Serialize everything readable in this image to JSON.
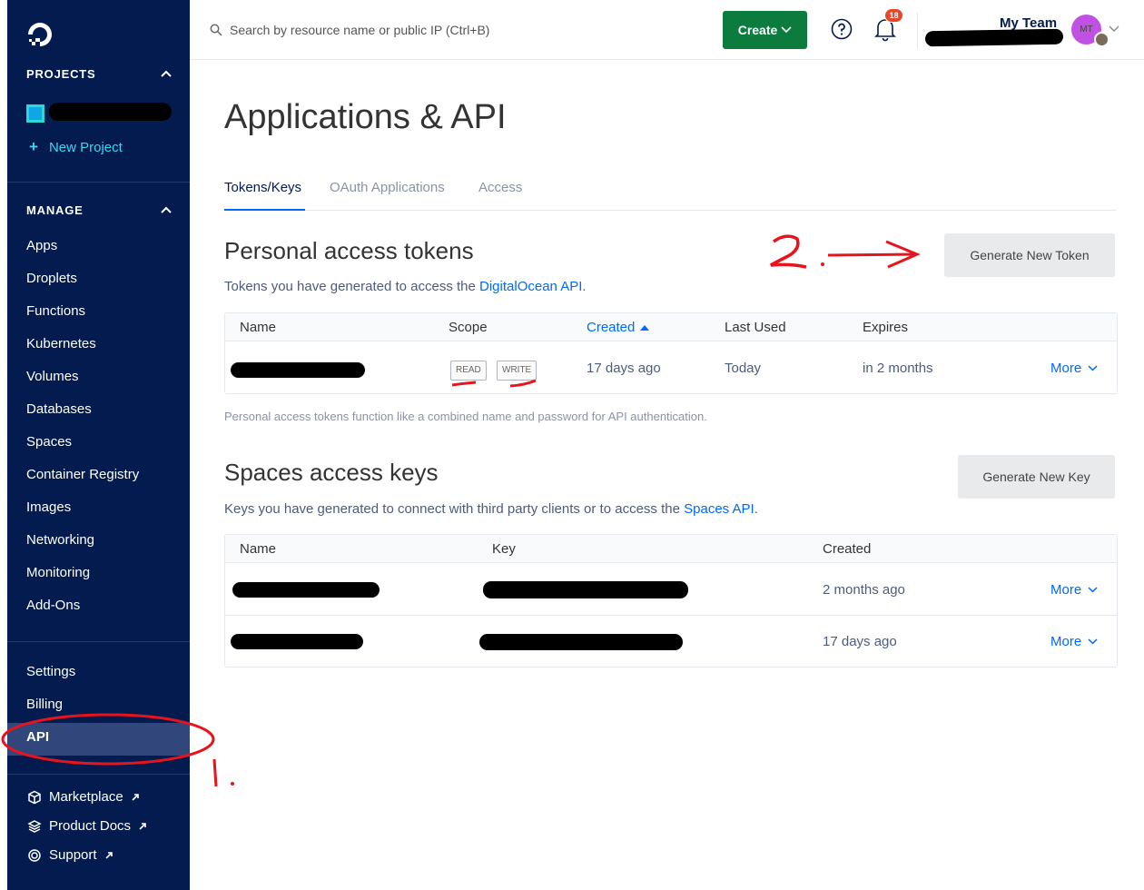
{
  "sidebar": {
    "projects_header": "PROJECTS",
    "new_project_label": "New Project",
    "manage_header": "MANAGE",
    "manage_items": [
      "Apps",
      "Droplets",
      "Functions",
      "Kubernetes",
      "Volumes",
      "Databases",
      "Spaces",
      "Container Registry",
      "Images",
      "Networking",
      "Monitoring",
      "Add-Ons"
    ],
    "account_items": [
      "Settings",
      "Billing",
      "API"
    ],
    "active_item": "API",
    "external_items": [
      "Marketplace",
      "Product Docs",
      "Support"
    ]
  },
  "topbar": {
    "search_placeholder": "Search by resource name or public IP (Ctrl+B)",
    "create_label": "Create",
    "notification_count": "18",
    "team_name": "My Team",
    "avatar_initials": "MT"
  },
  "page": {
    "title": "Applications & API",
    "tabs": [
      "Tokens/Keys",
      "OAuth Applications",
      "Access"
    ],
    "active_tab": "Tokens/Keys"
  },
  "tokens": {
    "title": "Personal access tokens",
    "desc_prefix": "Tokens you have generated to access the ",
    "desc_link": "DigitalOcean API",
    "desc_suffix": ".",
    "generate_label": "Generate New Token",
    "columns": [
      "Name",
      "Scope",
      "Created",
      "Last Used",
      "Expires"
    ],
    "rows": [
      {
        "scopes": [
          "READ",
          "WRITE"
        ],
        "created": "17 days ago",
        "last_used": "Today",
        "expires": "in 2 months",
        "action": "More"
      }
    ],
    "note": "Personal access tokens function like a combined name and password for API authentication."
  },
  "spaces": {
    "title": "Spaces access keys",
    "desc_prefix": "Keys you have generated to connect with third party clients or to access the ",
    "desc_link": "Spaces API",
    "desc_suffix": ".",
    "generate_label": "Generate New Key",
    "columns": [
      "Name",
      "Key",
      "Created"
    ],
    "rows": [
      {
        "created": "2 months ago",
        "action": "More"
      },
      {
        "created": "17 days ago",
        "action": "More"
      }
    ]
  },
  "annotations": {
    "step_1": "1.",
    "step_2": "2."
  },
  "colors": {
    "sidebar_bg": "#031b4e",
    "sidebar_active": "#31467a",
    "accent_blue": "#0069ff",
    "create_green": "#0b7c3e",
    "annotation_red": "#e8141b"
  }
}
